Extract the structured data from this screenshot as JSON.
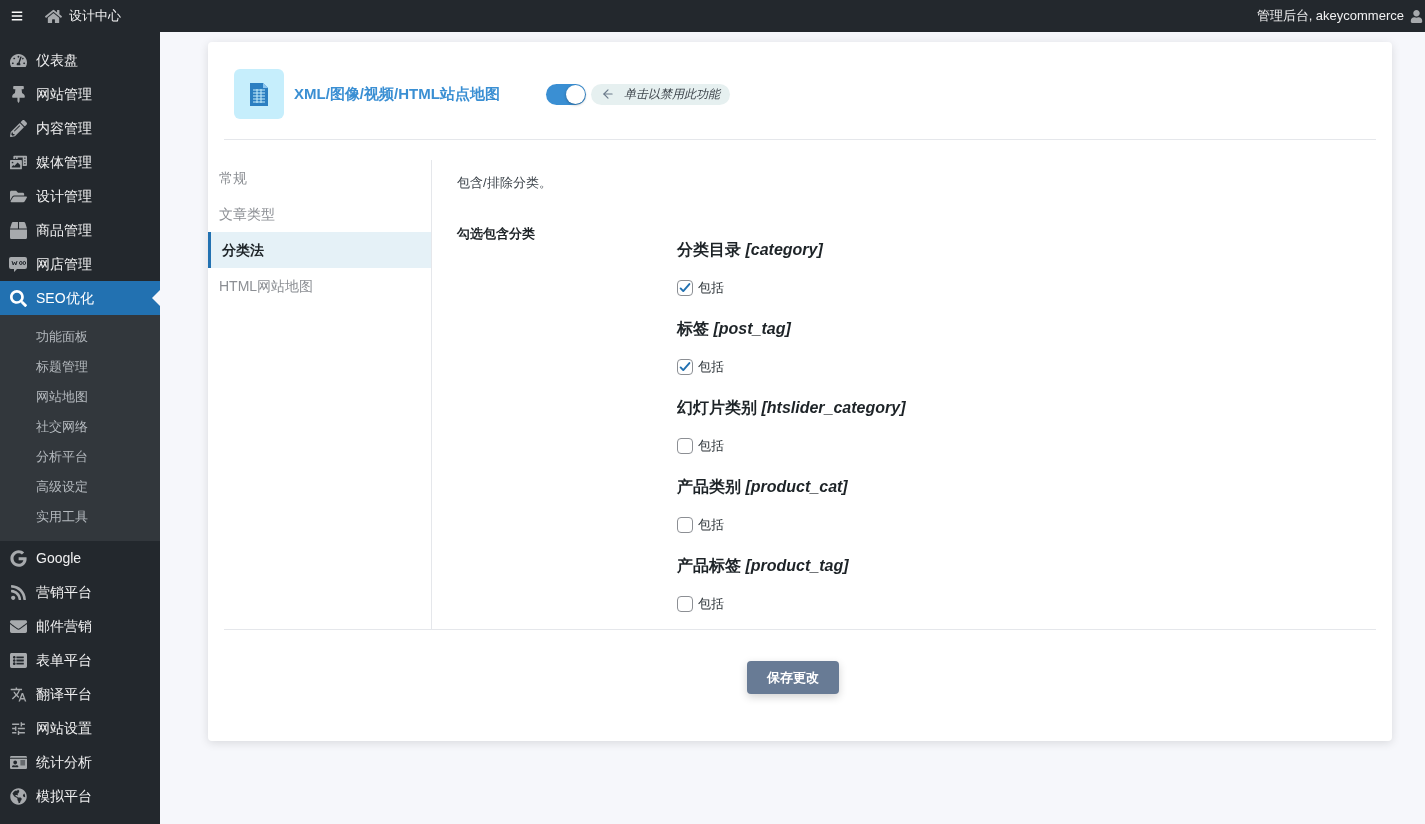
{
  "top_bar": {
    "site_name": "设计中心",
    "account": "管理后台, akeycommerce"
  },
  "sidebar": {
    "items": [
      {
        "label": "仪表盘",
        "selected": false
      },
      {
        "label": "网站管理",
        "selected": false
      },
      {
        "label": "内容管理",
        "selected": false
      },
      {
        "label": "媒体管理",
        "selected": false
      },
      {
        "label": "设计管理",
        "selected": false
      },
      {
        "label": "商品管理",
        "selected": false
      },
      {
        "label": "网店管理",
        "selected": false
      },
      {
        "label": "SEO优化",
        "selected": true,
        "expanded": true,
        "children": [
          {
            "label": "功能面板",
            "selected": false
          },
          {
            "label": "标题管理",
            "selected": false
          },
          {
            "label": "网站地图",
            "selected": false
          },
          {
            "label": "社交网络",
            "selected": false
          },
          {
            "label": "分析平台",
            "selected": false
          },
          {
            "label": "高级设定",
            "selected": false
          },
          {
            "label": "实用工具",
            "selected": false
          }
        ]
      },
      {
        "label": "Google",
        "selected": false
      },
      {
        "label": "营销平台",
        "selected": false
      },
      {
        "label": "邮件营销",
        "selected": false
      },
      {
        "label": "表单平台",
        "selected": false
      },
      {
        "label": "翻译平台",
        "selected": false
      },
      {
        "label": "网站设置",
        "selected": false
      },
      {
        "label": "统计分析",
        "selected": false
      },
      {
        "label": "模拟平台",
        "selected": false
      }
    ]
  },
  "module": {
    "title": "XML/图像/视频/HTML站点地图",
    "enabled": true,
    "toggle_hint": "单击以禁用此功能"
  },
  "tabs": [
    {
      "label": "常规",
      "selected": false
    },
    {
      "label": "文章类型",
      "selected": false
    },
    {
      "label": "分类法",
      "selected": true
    },
    {
      "label": "HTML网站地图",
      "selected": false
    }
  ],
  "section": {
    "description": "包含/排除分类。",
    "field_label": "勾选包含分类",
    "taxonomies": [
      {
        "heading": "分类目录 *[category]*",
        "checkbox_label": "包括",
        "checked": true
      },
      {
        "heading": "标签 *[post_tag]*",
        "checkbox_label": "包括",
        "checked": true
      },
      {
        "heading": "幻灯片类别 *[htslider_category]*",
        "checkbox_label": "包括",
        "checked": false
      },
      {
        "heading": "产品类别 *[product_cat]*",
        "checkbox_label": "包括",
        "checked": false
      },
      {
        "heading": "产品标签 *[product_tag]*",
        "checkbox_label": "包括",
        "checked": false
      }
    ]
  },
  "save_button": "保存更改"
}
